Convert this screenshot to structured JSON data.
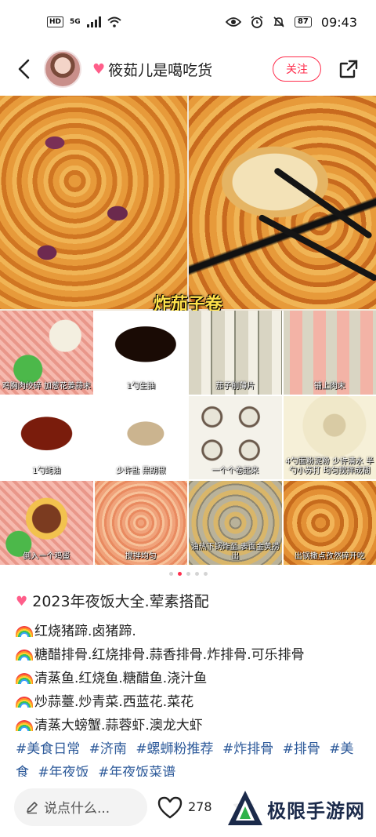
{
  "status_bar": {
    "hd": "HD",
    "network": "5G",
    "battery": "87",
    "time": "09:43"
  },
  "header": {
    "author_name": "筱茹儿是噶吃货",
    "follow_label": "关注"
  },
  "photo": {
    "main_caption": "炸茄子卷",
    "steps": [
      "鸡胸肉绞碎 加葱花姜蒜末",
      "1勺生抽",
      "茄子削薄片",
      "铺上肉末",
      "1勺蚝油",
      "少许盐 黑胡椒",
      "一个个卷起来",
      "4勺面粉淀粉 少许清水 半勺小苏打 均匀搅拌成糊",
      "倒入一个鸡蛋",
      "搅拌均匀",
      "油热下锅炸至 表面金黄捞出",
      "出锅撒点孜然碎开吃"
    ],
    "page_count": 5,
    "active_page": 2
  },
  "post": {
    "title": "2023年夜饭大全.荤素搭配",
    "lines": [
      "红烧猪蹄.卤猪蹄.",
      "糖醋排骨.红烧排骨.蒜香排骨.炸排骨.可乐排骨",
      "清蒸鱼.红烧鱼.糖醋鱼.浇汁鱼",
      "炒蒜薹.炒青菜.西蓝花.菜花",
      "清蒸大螃蟹.蒜蓉虾.澳龙大虾"
    ],
    "tags": [
      "#美食日常",
      "#济南",
      "#螺蛳粉推荐",
      "#炸排骨",
      "#排骨",
      "#美食",
      "#年夜饭",
      "#年夜饭菜谱"
    ]
  },
  "bottom_bar": {
    "comment_placeholder": "说点什么...",
    "like_count": "278"
  },
  "watermark": {
    "text": "极限手游网"
  },
  "colors": {
    "accent": "#ff2e4d",
    "tag": "#2d5a9a",
    "caption_yellow": "#ffe14a"
  }
}
